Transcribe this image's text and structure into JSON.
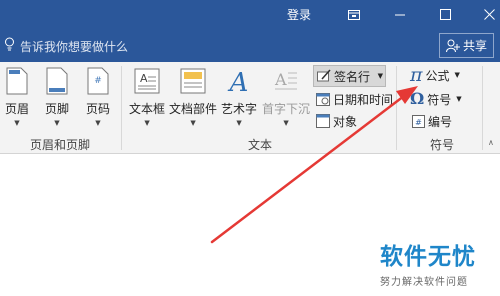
{
  "titlebar": {
    "login_label": "登录",
    "icons": [
      "ribbon-display-icon",
      "minimize-icon",
      "maximize-icon",
      "close-icon"
    ]
  },
  "tellme": {
    "placeholder": "告诉我你想要做什么",
    "share_label": "共享"
  },
  "ribbon": {
    "header_footer_group": {
      "label": "页眉和页脚",
      "buttons": [
        "页眉",
        "页脚",
        "页码"
      ]
    },
    "text_group": {
      "label": "文本",
      "textbox": "文本框",
      "quickparts": "文档部件",
      "wordart": "艺术字",
      "dropcap": "首字下沉",
      "signature": "签名行",
      "datetime": "日期和时间",
      "object": "对象"
    },
    "symbols_group": {
      "label": "符号",
      "equation": "公式",
      "symbol": "符号",
      "number": "编号"
    }
  },
  "watermark": {
    "title": "软件无忧",
    "subtitle": "努力解决软件问题"
  },
  "colors": {
    "title_bar": "#2b579a",
    "ribbon": "#f3f3f3",
    "arrow": "#e53935",
    "watermark": "#1f86c9"
  }
}
